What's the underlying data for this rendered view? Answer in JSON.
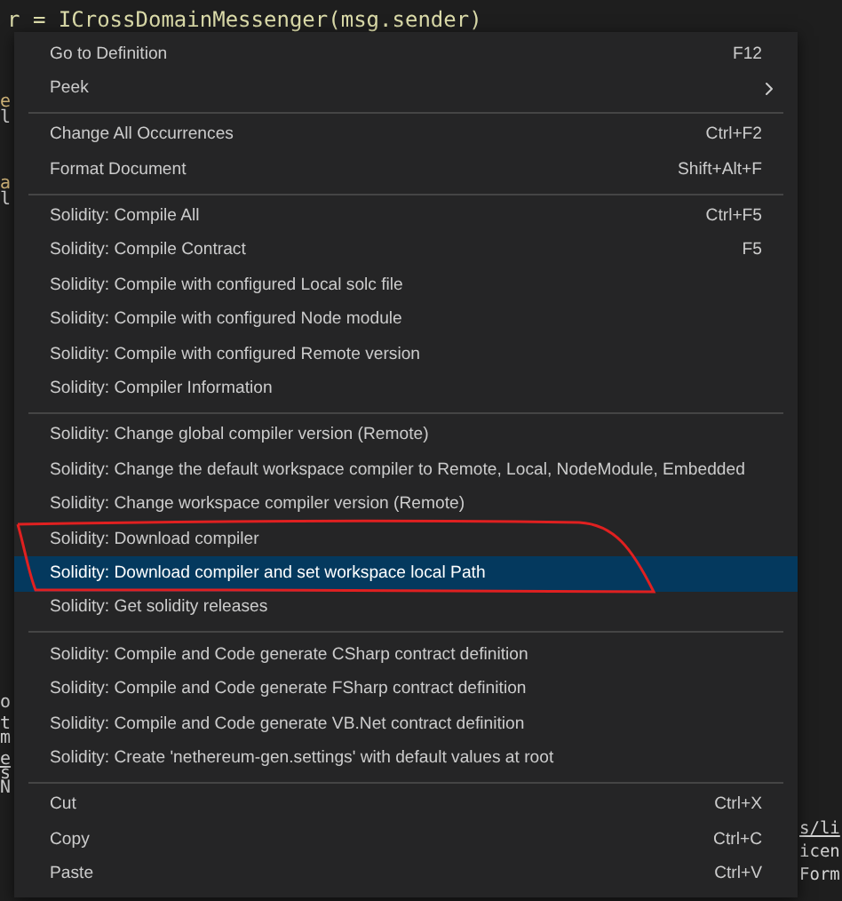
{
  "editor": {
    "top_line": "r = ICrossDomainMessenger(msg.sender)",
    "left_fragments": [
      {
        "text": "e",
        "kind": "type"
      },
      {
        "text": "l",
        "kind": "plain"
      },
      {
        "text": "a",
        "kind": "type"
      },
      {
        "text": "l",
        "kind": "plain"
      },
      {
        "text": "o",
        "kind": "plain"
      },
      {
        "text": "t",
        "kind": "plain"
      },
      {
        "text": "m",
        "kind": "plain"
      },
      {
        "text": "e",
        "kind": "link"
      },
      {
        "text": "s",
        "kind": "plain"
      },
      {
        "text": "N",
        "kind": "plain"
      }
    ],
    "right_fragments": [
      {
        "text": "s/li",
        "kind": "link"
      },
      {
        "text": "icen",
        "kind": "plain"
      },
      {
        "text": "Form",
        "kind": "plain"
      }
    ]
  },
  "context_menu": {
    "groups": [
      [
        {
          "label": "Go to Definition",
          "shortcut": "F12",
          "selected": false
        },
        {
          "label": "Peek",
          "submenu": true,
          "selected": false
        }
      ],
      [
        {
          "label": "Change All Occurrences",
          "shortcut": "Ctrl+F2",
          "selected": false
        },
        {
          "label": "Format Document",
          "shortcut": "Shift+Alt+F",
          "selected": false
        }
      ],
      [
        {
          "label": "Solidity: Compile All",
          "shortcut": "Ctrl+F5",
          "selected": false
        },
        {
          "label": "Solidity: Compile Contract",
          "shortcut": "F5",
          "selected": false
        },
        {
          "label": "Solidity: Compile with configured Local solc file",
          "selected": false
        },
        {
          "label": "Solidity: Compile with configured Node module",
          "selected": false
        },
        {
          "label": "Solidity: Compile with configured Remote version",
          "selected": false
        },
        {
          "label": "Solidity: Compiler Information",
          "selected": false
        }
      ],
      [
        {
          "label": "Solidity: Change global compiler version (Remote)",
          "selected": false
        },
        {
          "label": "Solidity: Change the default workspace compiler to Remote, Local, NodeModule, Embedded",
          "selected": false
        },
        {
          "label": "Solidity: Change workspace compiler version (Remote)",
          "selected": false
        },
        {
          "label": "Solidity: Download compiler",
          "selected": false
        },
        {
          "label": "Solidity: Download compiler and set workspace local Path",
          "selected": true
        },
        {
          "label": "Solidity: Get solidity releases",
          "selected": false
        }
      ],
      [
        {
          "label": "Solidity: Compile and Code generate CSharp contract definition",
          "selected": false
        },
        {
          "label": "Solidity: Compile and Code generate FSharp contract definition",
          "selected": false
        },
        {
          "label": "Solidity: Compile and Code generate VB.Net contract definition",
          "selected": false
        },
        {
          "label": "Solidity: Create 'nethereum-gen.settings' with default values at root",
          "selected": false
        }
      ],
      [
        {
          "label": "Cut",
          "shortcut": "Ctrl+X",
          "selected": false
        },
        {
          "label": "Copy",
          "shortcut": "Ctrl+C",
          "selected": false
        },
        {
          "label": "Paste",
          "shortcut": "Ctrl+V",
          "selected": false
        }
      ]
    ]
  }
}
